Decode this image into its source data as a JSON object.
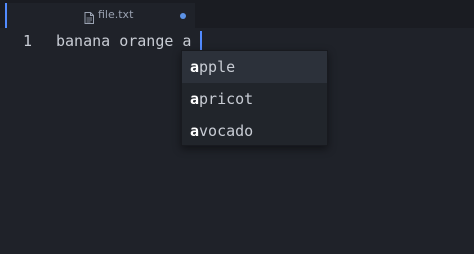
{
  "tab": {
    "title": "file.txt",
    "icon": "file-icon",
    "modified": true,
    "accent_color": "#528bff",
    "dot_color": "#5c92e6"
  },
  "editor": {
    "line_number": "1",
    "text": "banana orange a"
  },
  "autocomplete": {
    "typed_prefix": "a",
    "items": [
      {
        "match": "a",
        "rest": "pple",
        "selected": true
      },
      {
        "match": "a",
        "rest": "pricot",
        "selected": false
      },
      {
        "match": "a",
        "rest": "vocado",
        "selected": false
      }
    ]
  }
}
